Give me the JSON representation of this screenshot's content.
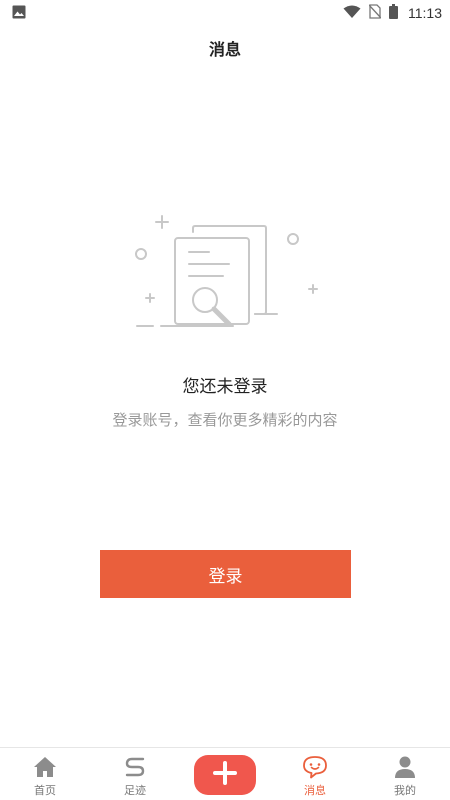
{
  "status_bar": {
    "time": "11:13"
  },
  "header": {
    "title": "消息"
  },
  "empty_state": {
    "title": "您还未登录",
    "description": "登录账号，查看你更多精彩的内容"
  },
  "login_button": {
    "label": "登录"
  },
  "tab_bar": {
    "items": [
      {
        "label": "首页",
        "icon": "home-icon"
      },
      {
        "label": "足迹",
        "icon": "footprint-icon"
      },
      {
        "label": "",
        "icon": "add-icon"
      },
      {
        "label": "消息",
        "icon": "message-icon",
        "active": true
      },
      {
        "label": "我的",
        "icon": "profile-icon"
      }
    ]
  },
  "colors": {
    "accent": "#ea5f3c",
    "add_button": "#f0574d",
    "text_secondary": "#999999"
  }
}
